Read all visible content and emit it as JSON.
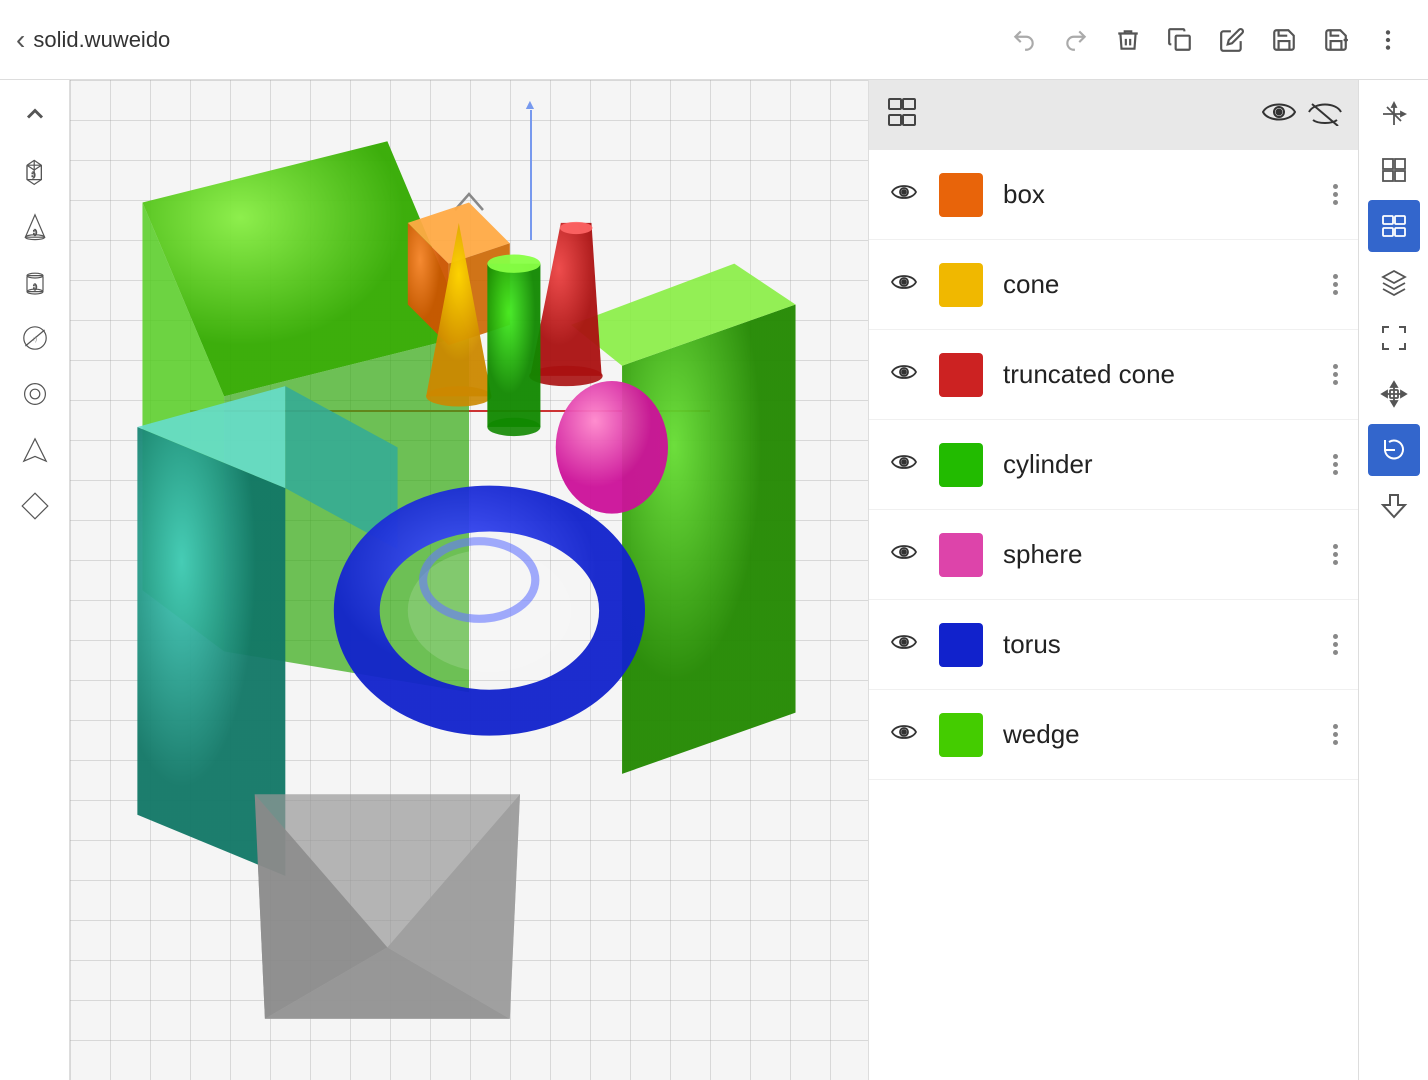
{
  "header": {
    "back_label": "‹",
    "title": "solid.wuweido",
    "toolbar_buttons": [
      {
        "id": "undo",
        "icon": "←",
        "label": "undo",
        "disabled": true
      },
      {
        "id": "redo",
        "icon": "→",
        "label": "redo",
        "disabled": true
      },
      {
        "id": "delete",
        "icon": "🗑",
        "label": "delete"
      },
      {
        "id": "duplicate",
        "icon": "⧉",
        "label": "duplicate"
      },
      {
        "id": "edit",
        "icon": "✏",
        "label": "edit"
      },
      {
        "id": "save",
        "icon": "💾",
        "label": "save"
      },
      {
        "id": "save-new",
        "icon": "📥",
        "label": "save-new"
      },
      {
        "id": "more",
        "icon": "⋮",
        "label": "more"
      }
    ]
  },
  "left_sidebar": {
    "items": [
      {
        "id": "up",
        "icon": "∧",
        "label": "collapse"
      },
      {
        "id": "cube",
        "icon": "◻",
        "label": "box-tool"
      },
      {
        "id": "triangle",
        "icon": "△",
        "label": "cone-tool"
      },
      {
        "id": "cylinder-cute",
        "icon": "⊙",
        "label": "cylinder-cute-tool"
      },
      {
        "id": "no-entry",
        "icon": "⊘",
        "label": "no-entry-tool"
      },
      {
        "id": "torus-tool",
        "icon": "◎",
        "label": "torus-tool"
      },
      {
        "id": "arrow-tool",
        "icon": "◁",
        "label": "arrow-tool"
      },
      {
        "id": "prism-tool",
        "icon": "◇",
        "label": "prism-tool"
      }
    ]
  },
  "panel": {
    "header_icon": "layers",
    "eye_icon": "👁",
    "slash_eye_icon": "eye-slash",
    "shapes": [
      {
        "id": "box",
        "name": "box",
        "color": "#e8640a",
        "visible": true
      },
      {
        "id": "cone",
        "name": "cone",
        "color": "#f0b800",
        "visible": true
      },
      {
        "id": "truncated_cone",
        "name": "truncated cone",
        "color": "#cc2222",
        "visible": true
      },
      {
        "id": "cylinder",
        "name": "cylinder",
        "color": "#22bb00",
        "visible": true
      },
      {
        "id": "sphere",
        "name": "sphere",
        "color": "#dd44aa",
        "visible": true
      },
      {
        "id": "torus",
        "name": "torus",
        "color": "#1122cc",
        "visible": true
      },
      {
        "id": "wedge",
        "name": "wedge",
        "color": "#44cc00",
        "visible": true
      }
    ]
  },
  "right_toolbar": {
    "items": [
      {
        "id": "axes",
        "icon": "⌖",
        "label": "axes-tool"
      },
      {
        "id": "grid",
        "icon": "#",
        "label": "grid-tool"
      },
      {
        "id": "layers-active",
        "icon": "≡",
        "label": "layers-active",
        "active": true
      },
      {
        "id": "stack",
        "icon": "⊞",
        "label": "stack-tool"
      },
      {
        "id": "frame",
        "icon": "⬜",
        "label": "frame-tool"
      },
      {
        "id": "move",
        "icon": "✛",
        "label": "move-tool"
      },
      {
        "id": "reset-active",
        "icon": "↺",
        "label": "reset-active",
        "active": true
      },
      {
        "id": "export",
        "icon": "⬇",
        "label": "export-tool"
      }
    ]
  }
}
